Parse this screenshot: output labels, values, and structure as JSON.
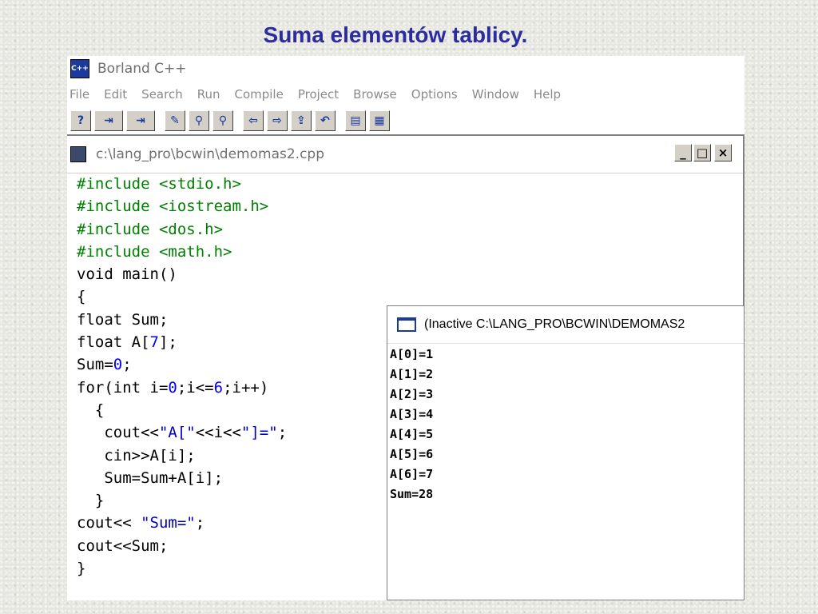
{
  "slide": {
    "title": "Suma elementów tablicy."
  },
  "app": {
    "icon_text": "C++",
    "title": "Borland C++",
    "menu": [
      "File",
      "Edit",
      "Search",
      "Run",
      "Compile",
      "Project",
      "Browse",
      "Options",
      "Window",
      "Help"
    ],
    "toolbar": [
      {
        "name": "help-icon",
        "glyph": "?"
      },
      {
        "name": "save-file-icon",
        "glyph": "⇥"
      },
      {
        "name": "save-all-icon",
        "glyph": "⇥"
      },
      {
        "name": "edit-icon",
        "glyph": "✎"
      },
      {
        "name": "find-icon",
        "glyph": "⚲"
      },
      {
        "name": "find-again-icon",
        "glyph": "⚲"
      },
      {
        "name": "compile-icon",
        "glyph": "⇦"
      },
      {
        "name": "make-icon",
        "glyph": "⇨"
      },
      {
        "name": "open-project-icon",
        "glyph": "⇪"
      },
      {
        "name": "undo-icon",
        "glyph": "↶"
      },
      {
        "name": "binary-icon",
        "glyph": "▤"
      },
      {
        "name": "binary-wide-icon",
        "glyph": "▦"
      }
    ]
  },
  "editor": {
    "title": "c:\\lang_pro\\bcwin\\demomas2.cpp",
    "controls": {
      "minimize": "_",
      "maximize": "□",
      "close": "×"
    },
    "code": [
      [
        {
          "t": "#include <stdio.h>",
          "c": "dir"
        }
      ],
      [
        {
          "t": "#include <iostream.h>",
          "c": "dir"
        }
      ],
      [
        {
          "t": "#include <dos.h>",
          "c": "dir"
        }
      ],
      [
        {
          "t": "#include <math.h>",
          "c": "dir"
        }
      ],
      [
        {
          "t": "void main()",
          "c": ""
        }
      ],
      [
        {
          "t": "{",
          "c": ""
        }
      ],
      [
        {
          "t": "float Sum;",
          "c": ""
        }
      ],
      [
        {
          "t": "float A[",
          "c": ""
        },
        {
          "t": "7",
          "c": "num"
        },
        {
          "t": "];",
          "c": ""
        }
      ],
      [
        {
          "t": "Sum=",
          "c": ""
        },
        {
          "t": "0",
          "c": "num"
        },
        {
          "t": ";",
          "c": ""
        }
      ],
      [
        {
          "t": "for(int i=",
          "c": ""
        },
        {
          "t": "0",
          "c": "num"
        },
        {
          "t": ";i<=",
          "c": ""
        },
        {
          "t": "6",
          "c": "num"
        },
        {
          "t": ";i++)",
          "c": ""
        }
      ],
      [
        {
          "t": "  {",
          "c": ""
        }
      ],
      [
        {
          "t": "   cout<<",
          "c": ""
        },
        {
          "t": "\"A[\"",
          "c": "str"
        },
        {
          "t": "<<i<<",
          "c": ""
        },
        {
          "t": "\"]=\"",
          "c": "str"
        },
        {
          "t": ";",
          "c": ""
        }
      ],
      [
        {
          "t": "   cin>>A[i];",
          "c": ""
        }
      ],
      [
        {
          "t": "   Sum=Sum+A[i];",
          "c": ""
        }
      ],
      [
        {
          "t": "  }",
          "c": ""
        }
      ],
      [
        {
          "t": "cout<< ",
          "c": ""
        },
        {
          "t": "\"Sum=\"",
          "c": "str"
        },
        {
          "t": ";",
          "c": ""
        }
      ],
      [
        {
          "t": "cout<<Sum;",
          "c": ""
        }
      ],
      [
        {
          "t": "}",
          "c": ""
        }
      ]
    ]
  },
  "output": {
    "title": "(Inactive C:\\LANG_PRO\\BCWIN\\DEMOMAS2",
    "lines": [
      "A[0]=1",
      "A[1]=2",
      "A[2]=3",
      "A[3]=4",
      "A[4]=5",
      "A[5]=6",
      "A[6]=7",
      "Sum=28"
    ]
  }
}
